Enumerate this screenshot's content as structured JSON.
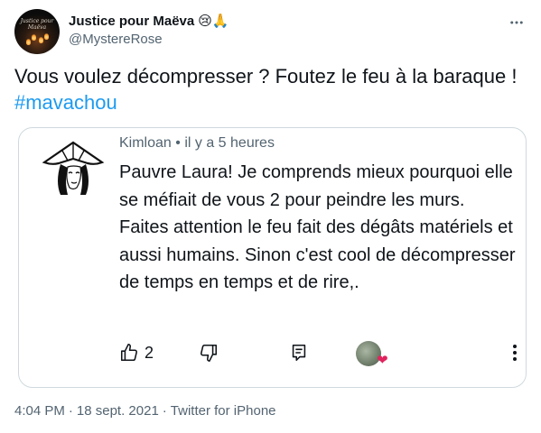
{
  "author": {
    "display_name": "Justice pour Maëva",
    "emoji": "😢🙏",
    "handle": "@MystereRose",
    "avatar_text": "Justice pour Maëva"
  },
  "tweet": {
    "text": "Vous voulez décompresser ? Foutez le feu à la baraque ! ",
    "hashtag": "#mavachou"
  },
  "embedded_comment": {
    "author": "Kimloan",
    "dot": "•",
    "time": "il y a 5 heures",
    "text": "Pauvre Laura! Je comprends mieux pourquoi elle se méfiait de vous 2 pour peindre les murs. Faites attention le feu fait des dégâts matériels et aussi  humains. Sinon c'est cool de décompresser de temps en temps et de rire,.",
    "like_count": "2",
    "icons": [
      "thumbs-up-icon",
      "thumbs-down-icon",
      "comment-icon",
      "reaction-avatar",
      "heart-icon",
      "more-vertical-icon"
    ]
  },
  "footer": {
    "time": "4:04 PM",
    "date": "18 sept. 2021",
    "source": "Twitter for iPhone",
    "sep": "·"
  },
  "colors": {
    "link": "#1d9bf0",
    "secondary": "#536471",
    "border": "#cfd9de",
    "heart": "#e0245e"
  }
}
